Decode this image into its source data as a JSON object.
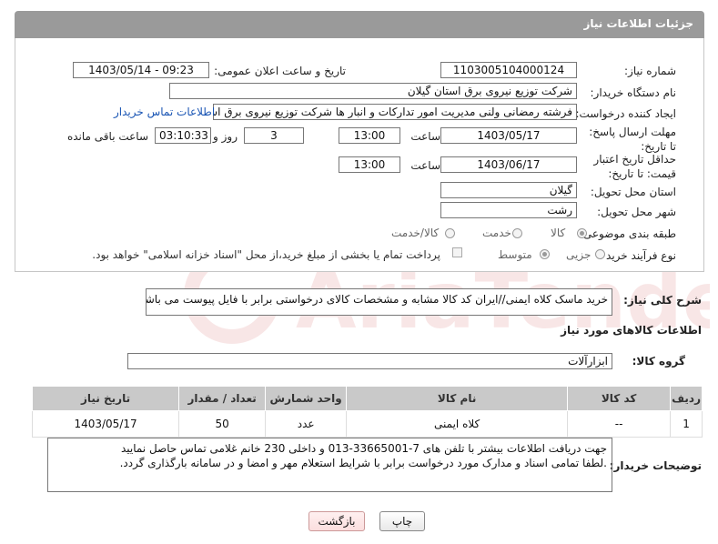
{
  "header": {
    "title": "جزئیات اطلاعات نیاز"
  },
  "form": {
    "need_number_label": "شماره نیاز:",
    "need_number": "1103005104000124",
    "announce_label": "تاریخ و ساعت اعلان عمومی:",
    "announce_value": "1403/05/14 - 09:23",
    "buyer_org_label": "نام دستگاه خریدار:",
    "buyer_org": "شرکت توزیع نیروی برق استان گیلان",
    "creator_label": "ایجاد کننده درخواست:",
    "creator": "فرشته رمضانی ولنی مدیریت امور تدارکات و انبار ها شرکت توزیع نیروی برق استان گیلان",
    "contact_link": "اطلاعات تماس خریدار",
    "reply_deadline_label": "مهلت ارسال پاسخ: تا تاریخ:",
    "reply_date": "1403/05/17",
    "time_label": "ساعت",
    "reply_time": "13:00",
    "days_value": "3",
    "days_label": "روز و",
    "remaining_value": "03:10:33",
    "remaining_label": "ساعت باقی مانده",
    "price_valid_label": "حداقل تاریخ اعتبار قیمت: تا تاریخ:",
    "price_date": "1403/06/17",
    "price_time": "13:00",
    "province_label": "استان محل تحویل:",
    "province": "گیلان",
    "city_label": "شهر محل تحویل:",
    "city": "رشت",
    "category_label": "طبقه بندی موضوعی:",
    "category_options": [
      "کالا",
      "خدمت",
      "کالا/خدمت"
    ],
    "purchase_type_label": "نوع فرآیند خرید :",
    "purchase_options": [
      "جزیی",
      "متوسط"
    ],
    "payment_note": "پرداخت تمام یا بخشی از مبلغ خرید،از محل \"اسناد خزانه اسلامی\" خواهد بود."
  },
  "description": {
    "label": "شرح کلی نیاز:",
    "text": "خرید ماسک کلاه ایمنی//ایران کد کالا مشابه و مشخصات کالای درخواستی برابر با فایل پیوست می باشد."
  },
  "goods": {
    "section_title": "اطلاعات کالاهای مورد نیاز",
    "group_label": "گروه کالا:",
    "group_value": "ابزارآلات",
    "columns": [
      "ردیف",
      "کد کالا",
      "نام کالا",
      "واحد شمارش",
      "تعداد / مقدار",
      "تاریخ نیاز"
    ],
    "rows": [
      {
        "row": "1",
        "code": "--",
        "name": "کلاه ایمنی",
        "unit": "عدد",
        "qty": "50",
        "date": "1403/05/17"
      }
    ]
  },
  "buyer_notes": {
    "label": "توضیحات خریدار:",
    "line1": "جهت دریافت اطلاعات بیشتر با تلفن های 7-33665001-013 و داخلی 230 خانم غلامی تماس حاصل نمایید",
    "line2": ".لطفا تمامی اسناد و مدارک مورد درخواست برابر با شرایط استعلام مهر و امضا و در سامانه بارگذاری گردد."
  },
  "buttons": {
    "print": "چاپ",
    "back": "بازگشت"
  },
  "watermark": {
    "text": "AriaTender.neT"
  },
  "colors": {
    "header_bg": "#9a9a9a",
    "link": "#1a55b4",
    "back_btn_bg": "#fde3e3",
    "watermark": "#c62828"
  }
}
